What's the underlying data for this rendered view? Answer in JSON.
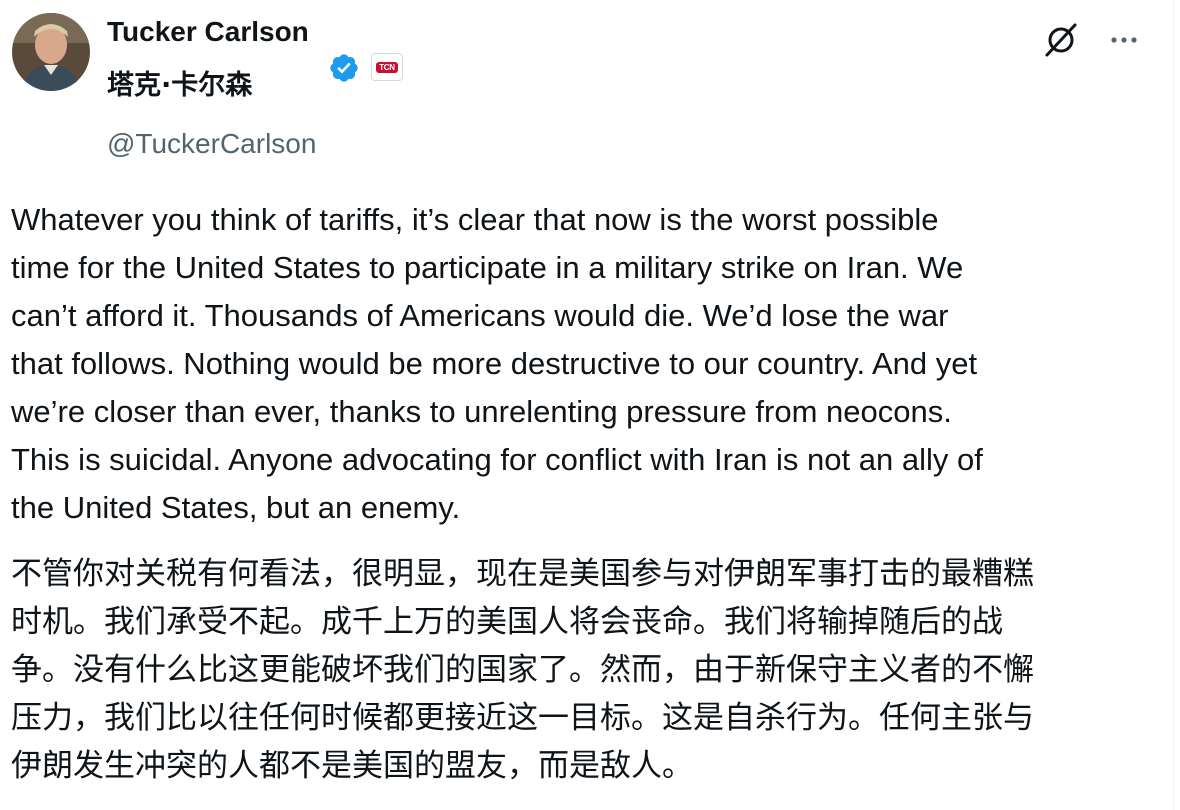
{
  "author": {
    "display_name": "Tucker Carlson",
    "display_name_cn": "塔克·卡尔森",
    "handle": "@TuckerCarlson",
    "verified": true,
    "affiliate_badge_text": "TCN"
  },
  "actions": {
    "grok_icon": "grok-icon",
    "more_icon": "more-horizontal-icon"
  },
  "tweet": {
    "text_en": "Whatever you think of tariffs, it’s clear that now is the worst possible\ntime for the United States to participate in a military strike on Iran. We\ncan’t afford it. Thousands of Americans would die. We’d lose the war\nthat follows. Nothing would be more destructive to our country. And yet\nwe’re closer than ever, thanks to unrelenting pressure from neocons.\nThis is suicidal. Anyone advocating for conflict with Iran is not an ally of\nthe United States, but an enemy.",
    "text_cn": "不管你对关税有何看法，很明显，现在是美国参与对伊朗军事打击的最糟糕\n时机。我们承受不起。成千上万的美国人将会丧命。我们将输掉随后的战\n争。没有什么比这更能破坏我们的国家了。然而，由于新保守主义者的不懈\n压力，我们比以往任何时候都更接近这一目标。这是自杀行为。任何主张与\n伊朗发生冲突的人都不是美国的盟友，而是敌人。"
  },
  "colors": {
    "text_primary": "#0f1419",
    "text_secondary": "#536471",
    "verified_blue": "#1d9bf0",
    "affiliate_red": "#c8102e"
  }
}
